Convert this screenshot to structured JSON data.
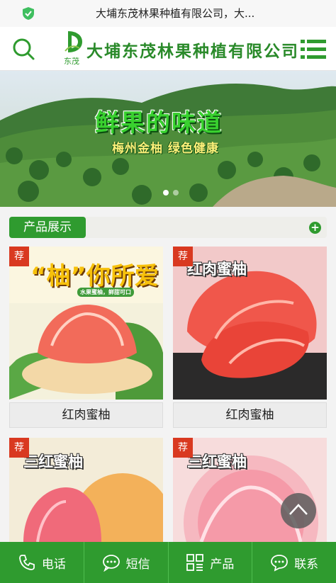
{
  "browser": {
    "page_title": "大埔东茂林果种植有限公司，大..."
  },
  "header": {
    "company_name": "大埔东茂林果种植有限公司",
    "logo_text": "东茂",
    "icons": {
      "search": "search-icon",
      "menu": "menu-icon",
      "secure": "shield-check-icon"
    }
  },
  "banner": {
    "title": "鲜果的味道",
    "subtitle": "梅州金柚  绿色健康",
    "slides": 2,
    "active_slide": 1
  },
  "section": {
    "title": "产品展示",
    "more_label": "+"
  },
  "products": [
    {
      "badge": "荐",
      "label": "红肉蜜柚",
      "image_text": "“柚”你所爱",
      "image_small": "水果蜜柚，鲜甜可口"
    },
    {
      "badge": "荐",
      "label": "红肉蜜柚",
      "image_text": "红肉蜜柚"
    },
    {
      "badge": "荐",
      "label": "三红蜜柚",
      "image_text": "三红蜜柚"
    },
    {
      "badge": "荐",
      "label": "三红蜜柚",
      "image_text": "三红蜜柚"
    }
  ],
  "bottom_nav": [
    {
      "label": "电话",
      "icon": "phone-icon"
    },
    {
      "label": "短信",
      "icon": "message-icon"
    },
    {
      "label": "产品",
      "icon": "grid-icon"
    },
    {
      "label": "联系",
      "icon": "chat-icon"
    }
  ],
  "colors": {
    "brand_green": "#2f9b2f",
    "badge_red": "#d93920"
  }
}
